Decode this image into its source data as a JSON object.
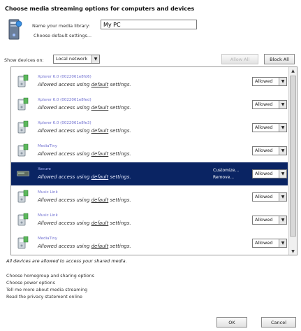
{
  "dialog": {
    "title": "Choose media streaming options for computers and devices"
  },
  "library": {
    "name_label": "Name your media library:",
    "name_value": "My PC",
    "choose_defaults_link": "Choose default settings..."
  },
  "filter": {
    "show_devices_label": "Show devices on:",
    "show_devices_value": "Local network"
  },
  "buttons": {
    "allow_all": "Allow All",
    "block_all": "Block All",
    "ok": "OK",
    "cancel": "Cancel"
  },
  "devices": [
    {
      "name": "Xplorer 6.0 (0022061e8fd6)",
      "status_prefix": "Allowed access using ",
      "status_default": "default",
      "status_suffix": " settings.",
      "permission": "Allowed"
    },
    {
      "name": "Xplorer 6.0 (0022061e8fed)",
      "status_prefix": "Allowed access using ",
      "status_default": "default",
      "status_suffix": " settings.",
      "permission": "Allowed"
    },
    {
      "name": "Xplorer 6.0 (0022061e8fe3)",
      "status_prefix": "Allowed access using ",
      "status_default": "default",
      "status_suffix": " settings.",
      "permission": "Allowed"
    },
    {
      "name": "MediaTiny",
      "status_prefix": "Allowed access using ",
      "status_default": "default",
      "status_suffix": " settings.",
      "permission": "Allowed"
    },
    {
      "name": "Xecure",
      "status_prefix": "Allowed access using ",
      "status_default": "default",
      "status_suffix": " settings.",
      "permission": "Allowed",
      "selected": true,
      "customize": "Customize...",
      "remove": "Remove..."
    },
    {
      "name": "Music Link",
      "status_prefix": "Allowed access using ",
      "status_default": "default",
      "status_suffix": " settings.",
      "permission": "Allowed"
    },
    {
      "name": "Music Link",
      "status_prefix": "Allowed access using ",
      "status_default": "default",
      "status_suffix": " settings.",
      "permission": "Allowed"
    },
    {
      "name": "MediaTiny",
      "status_prefix": "Allowed access using ",
      "status_default": "default",
      "status_suffix": " settings.",
      "permission": "Allowed"
    }
  ],
  "footer": {
    "note": "All devices are allowed to access your shared media.",
    "links": [
      "Choose homegroup and sharing options",
      "Choose power options",
      "Tell me more about media streaming",
      "Read the privacy statement online"
    ]
  },
  "colors": {
    "selection": "#0a2463",
    "device_name": "#6f6fd0"
  },
  "icons": {
    "library": "media-server-icon",
    "device": "media-device-icon",
    "selected_device": "player-device-icon"
  }
}
